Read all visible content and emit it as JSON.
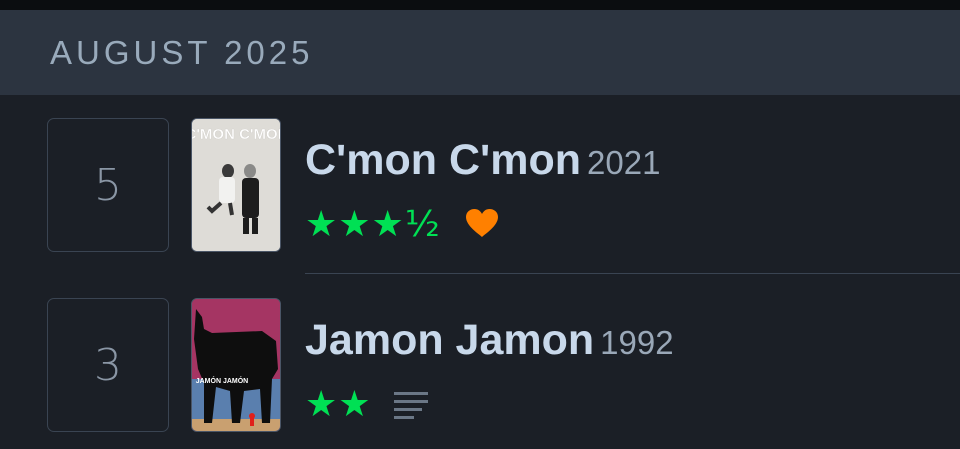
{
  "month_header": {
    "title": "AUGUST 2025"
  },
  "entries": [
    {
      "day": "5",
      "title": "C'mon C'mon",
      "year": "2021",
      "rating": "★★★½",
      "rating_value": 3.5,
      "liked": true,
      "has_review": false,
      "poster_text": "C'MON C'MON",
      "colors": {
        "star": "#00e054",
        "heart": "#ff8000"
      }
    },
    {
      "day": "3",
      "title": "Jamon Jamon",
      "year": "1992",
      "rating": "★★",
      "rating_value": 2,
      "liked": false,
      "has_review": true,
      "poster_text": "JAMÓN JAMÓN",
      "colors": {
        "star": "#00e054",
        "review_icon": "#6b7786"
      }
    }
  ]
}
